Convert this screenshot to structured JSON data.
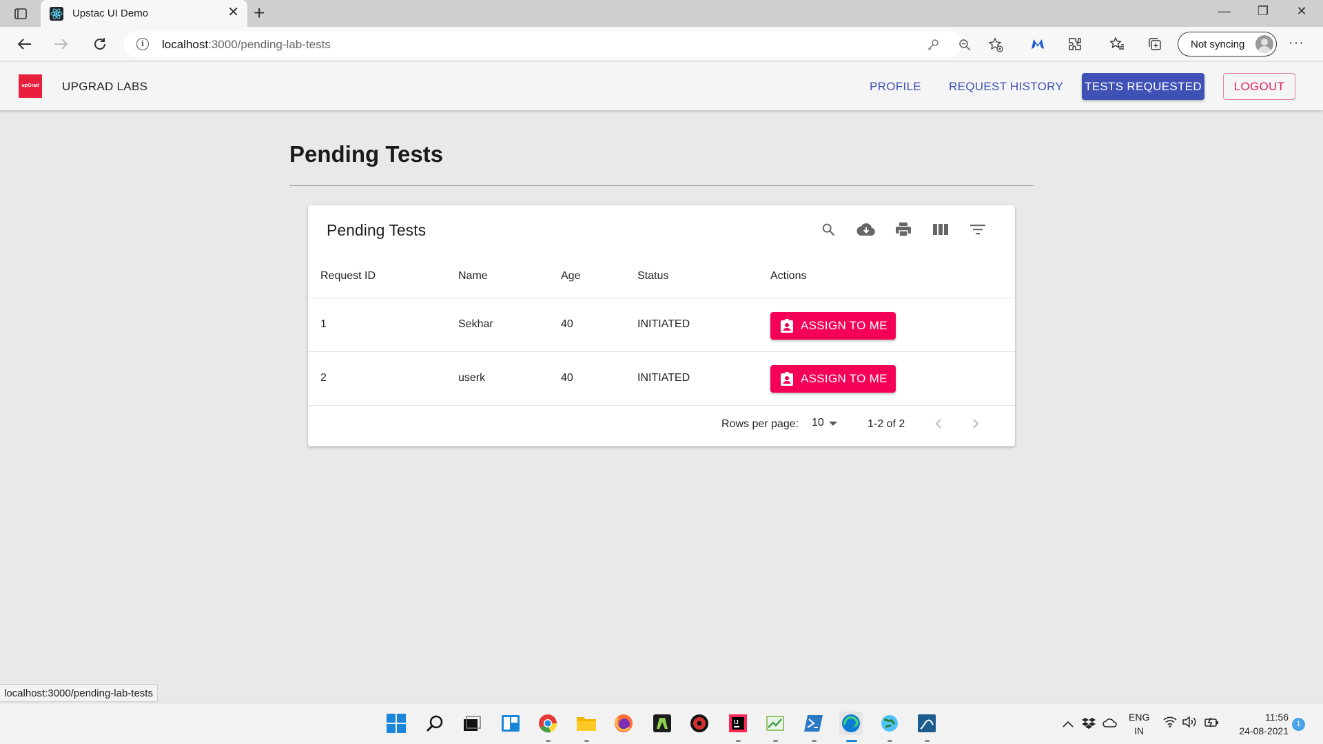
{
  "browser": {
    "tab_title": "Upstac UI Demo",
    "url_host": "localhost",
    "url_rest": ":3000/pending-lab-tests",
    "sync_label": "Not syncing",
    "status_url": "localhost:3000/pending-lab-tests"
  },
  "appbar": {
    "logo_text": "upGrad",
    "brand": "UPGRAD LABS",
    "nav": {
      "profile": "PROFILE",
      "history": "REQUEST HISTORY",
      "tests_requested": "TESTS REQUESTED",
      "logout": "LOGOUT"
    },
    "colors": {
      "primary": "#3f51b5",
      "secondary": "#f50057"
    }
  },
  "page": {
    "title": "Pending Tests"
  },
  "table": {
    "title": "Pending Tests",
    "toolbar_icons": [
      "search-icon",
      "cloud-download-icon",
      "print-icon",
      "view-column-icon",
      "filter-list-icon"
    ],
    "columns": {
      "request_id": "Request ID",
      "name": "Name",
      "age": "Age",
      "status": "Status",
      "actions": "Actions"
    },
    "rows": [
      {
        "request_id": "1",
        "name": "Sekhar",
        "age": "40",
        "status": "INITIATED",
        "action": "ASSIGN TO ME"
      },
      {
        "request_id": "2",
        "name": "userk",
        "age": "40",
        "status": "INITIATED",
        "action": "ASSIGN TO ME"
      }
    ],
    "pagination": {
      "rows_per_page_label": "Rows per page:",
      "rows_per_page": "10",
      "range": "1-2 of 2"
    }
  },
  "taskbar": {
    "lang_line1": "ENG",
    "lang_line2": "IN",
    "time": "11:56",
    "date": "24-08-2021",
    "notification_count": "1"
  }
}
